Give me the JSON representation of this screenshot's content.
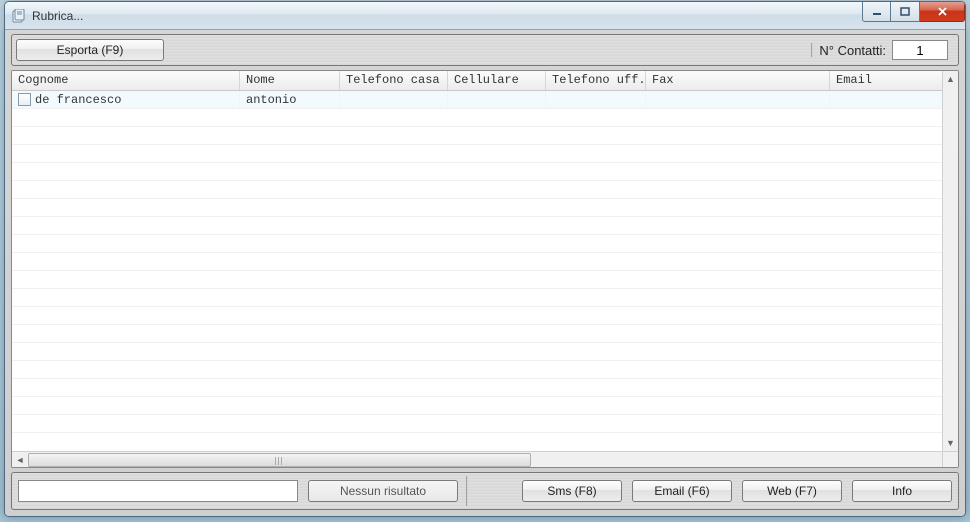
{
  "window": {
    "title": "Rubrica..."
  },
  "toolbar": {
    "export_label": "Esporta (F9)",
    "count_label": "N° Contatti:",
    "count_value": "1"
  },
  "table": {
    "columns": [
      "Cognome",
      "Nome",
      "Telefono casa",
      "Cellulare",
      "Telefono uff.",
      "Fax",
      "Email"
    ],
    "rows": [
      {
        "cognome": "de francesco",
        "nome": "antonio",
        "tel_casa": "",
        "cellulare": "",
        "tel_uff": "",
        "fax": "",
        "email": ""
      }
    ]
  },
  "bottombar": {
    "search_value": "",
    "status_label": "Nessun risultato",
    "sms_label": "Sms  (F8)",
    "email_label": "Email  (F6)",
    "web_label": "Web  (F7)",
    "info_label": "Info"
  }
}
